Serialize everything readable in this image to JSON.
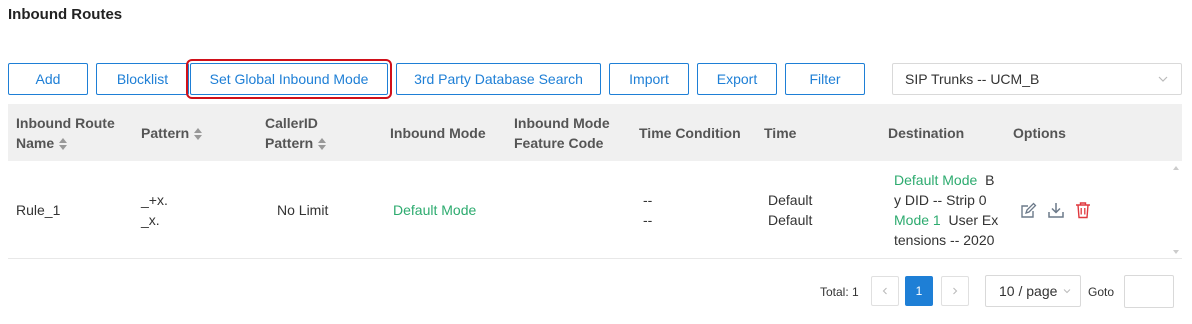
{
  "page": {
    "title": "Inbound Routes"
  },
  "toolbar": {
    "add": "Add",
    "blocklist": "Blocklist",
    "set_global": "Set Global Inbound Mode",
    "third_party": "3rd Party Database Search",
    "import": "Import",
    "export": "Export",
    "filter": "Filter"
  },
  "trunk_select": {
    "value": "SIP Trunks -- UCM_B"
  },
  "columns": {
    "name_1": "Inbound Route",
    "name_2": "Name",
    "pattern": "Pattern",
    "callerid_1": "CallerID",
    "callerid_2": "Pattern",
    "inbound_mode": "Inbound Mode",
    "feature_1": "Inbound Mode",
    "feature_2": "Feature Code",
    "time_condition": "Time Condition",
    "time": "Time",
    "destination": "Destination",
    "options": "Options"
  },
  "rows": [
    {
      "name": "Rule_1",
      "pattern_1": "_+x.",
      "pattern_2": "_x.",
      "callerid": "No Limit",
      "inbound_mode": "Default Mode",
      "time_condition_1": "--",
      "time_condition_2": "--",
      "time_1": "Default",
      "time_2": "Default",
      "dest_mode_1": "Default Mode",
      "dest_text_1a": "B",
      "dest_text_1b": "y DID -- Strip 0",
      "dest_mode_2": "Mode 1",
      "dest_text_2a": "User Ex",
      "dest_text_2b": "tensions -- 2020"
    }
  ],
  "pagination": {
    "total": "Total: 1",
    "current_page": "1",
    "page_size": "10 / page",
    "goto_label": "Goto"
  },
  "colors": {
    "accent": "#1e7fd6",
    "green": "#2dab6f",
    "danger": "#e0383e",
    "highlight": "#d0101a"
  }
}
